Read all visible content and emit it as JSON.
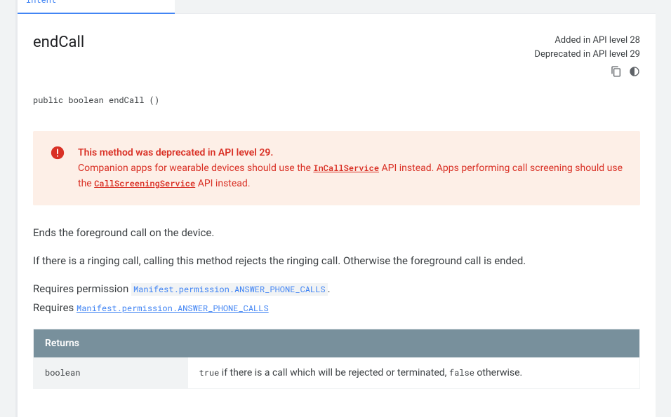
{
  "tab": {
    "label": "Intent"
  },
  "method": {
    "name": "endCall",
    "added": "Added in API level 28",
    "deprecated": "Deprecated in API level 29",
    "signature": "public boolean endCall ()"
  },
  "deprecation": {
    "title": "This method was deprecated in API level 29.",
    "body_pre": "Companion apps for wearable devices should use the ",
    "link1": "InCallService",
    "body_mid": " API instead. Apps performing call screening should use the ",
    "link2": "CallScreeningService",
    "body_post": " API instead."
  },
  "description": {
    "p1": "Ends the foreground call on the device.",
    "p2": "If there is a ringing call, calling this method rejects the ringing call. Otherwise the foreground call is ended.",
    "p3_pre": "Requires permission ",
    "p3_code": "Manifest.permission.ANSWER_PHONE_CALLS",
    "p3_post": ".",
    "p4_pre": "Requires ",
    "p4_code": "Manifest.permission.ANSWER_PHONE_CALLS"
  },
  "returns": {
    "header": "Returns",
    "type": "boolean",
    "desc_code1": "true",
    "desc_mid": " if there is a call which will be rejected or terminated, ",
    "desc_code2": "false",
    "desc_post": " otherwise."
  }
}
